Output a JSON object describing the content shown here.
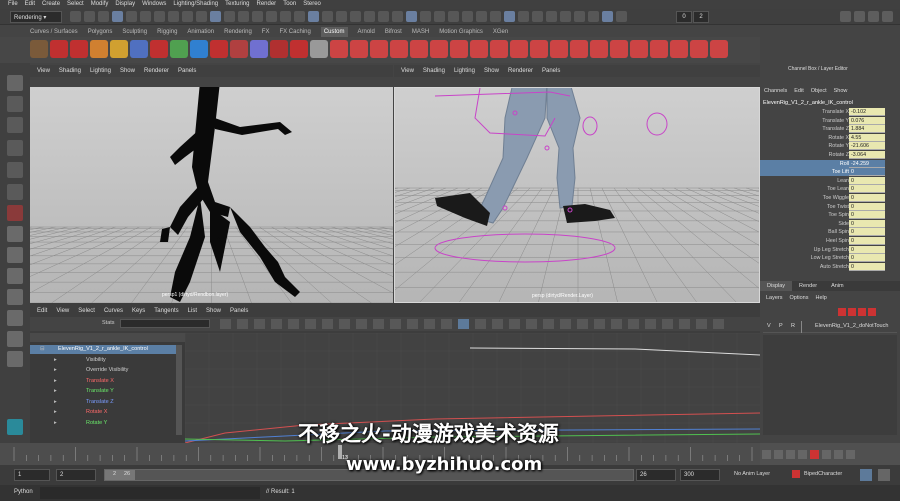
{
  "menubar": [
    "File",
    "Edit",
    "Create",
    "Select",
    "Modify",
    "Display",
    "Windows",
    "Lighting/Shading",
    "Texturing",
    "Render",
    "Toon",
    "Stereo"
  ],
  "status": {
    "mode": "Rendering",
    "field1": "0",
    "field2": "2"
  },
  "shelf_tabs": [
    "Curves / Surfaces",
    "Polygons",
    "Sculpting",
    "Rigging",
    "Animation",
    "Rendering",
    "FX",
    "FX Caching",
    "Custom",
    "Arnold",
    "Bifrost",
    "MASH",
    "Motion Graphics",
    "XGen"
  ],
  "shelf_active": "Custom",
  "viewport_menu": [
    "View",
    "Shading",
    "Lighting",
    "Show",
    "Renderer",
    "Panels"
  ],
  "left_viewport_label": "persp1 (dirtyd/Rendbon.layer)",
  "right_viewport_label": "persp (dirtyd/Render.Layer)",
  "channel_box": {
    "title": "Channel Box / Layer Editor",
    "menu": [
      "Channels",
      "Edit",
      "Object",
      "Show"
    ],
    "node": "ElevenRig_V1_2_r_ankle_IK_control",
    "channels": [
      {
        "name": "Translate X",
        "value": "-0.102"
      },
      {
        "name": "Translate Y",
        "value": "0.076"
      },
      {
        "name": "Translate Z",
        "value": "1.884"
      },
      {
        "name": "Rotate X",
        "value": "4.55"
      },
      {
        "name": "Rotate Y",
        "value": "-21.606"
      },
      {
        "name": "Rotate Z",
        "value": "-3.064"
      },
      {
        "name": "Roll",
        "value": "-24.259"
      },
      {
        "name": "Toe Lift",
        "value": "0"
      },
      {
        "name": "Lean",
        "value": "0"
      },
      {
        "name": "Toe Lean",
        "value": "0"
      },
      {
        "name": "Toe Wiggle",
        "value": "0"
      },
      {
        "name": "Toe Twist",
        "value": "0"
      },
      {
        "name": "Toe Spin",
        "value": "0"
      },
      {
        "name": "Side",
        "value": "0"
      },
      {
        "name": "Ball Spin",
        "value": "0"
      },
      {
        "name": "Heel Spin",
        "value": "0"
      },
      {
        "name": "Up Leg Stretch",
        "value": "0"
      },
      {
        "name": "Low Leg Stretch",
        "value": "0"
      },
      {
        "name": "Auto Stretch",
        "value": "0"
      }
    ]
  },
  "layer_editor": {
    "tabs": [
      "Display",
      "Render",
      "Anim"
    ],
    "active_tab": "Display",
    "menu": [
      "Layers",
      "Options",
      "Help"
    ],
    "layer": {
      "v": "V",
      "p": "P",
      "r": "R",
      "name": "ElevenRig_V1_2_doNotTouch"
    }
  },
  "graph_editor": {
    "menu": [
      "Edit",
      "View",
      "Select",
      "Curves",
      "Keys",
      "Tangents",
      "List",
      "Show",
      "Panels"
    ],
    "stats_label": "Stats",
    "outliner": [
      {
        "label": "ElevenRig_V1_2_r_ankle_IK_control",
        "color": "#ffffff"
      },
      {
        "label": "Visibility",
        "color": "#cfcfcf"
      },
      {
        "label": "Override Visibility",
        "color": "#cfcfcf"
      },
      {
        "label": "Translate X",
        "color": "#ff6a6a"
      },
      {
        "label": "Translate Y",
        "color": "#6ae86a"
      },
      {
        "label": "Translate Z",
        "color": "#7a9cff"
      },
      {
        "label": "Rotate X",
        "color": "#ff6a6a"
      },
      {
        "label": "Rotate Y",
        "color": "#6ae86a"
      }
    ]
  },
  "timeline": {
    "ticks": [
      "1",
      "",
      "",
      "",
      "",
      "",
      "",
      "",
      "",
      "",
      "",
      "",
      "",
      "",
      "",
      "",
      "",
      "",
      "",
      "",
      "",
      "",
      "",
      "",
      "",
      "",
      "",
      "",
      "",
      "",
      "",
      "",
      "",
      ""
    ],
    "current": "13"
  },
  "range": {
    "start": "1",
    "start2": "2",
    "inner_start": "2",
    "inner_end": "26",
    "end": "26",
    "end2": "300",
    "anim_layer": "No Anim Layer",
    "char_set": "BipedCharacter"
  },
  "cmdline": {
    "lang": "Python",
    "result": "// Result: 1"
  },
  "watermark": {
    "line1": "不移之火-动漫游戏美术资源",
    "line2": "www.byzhihuo.com"
  }
}
